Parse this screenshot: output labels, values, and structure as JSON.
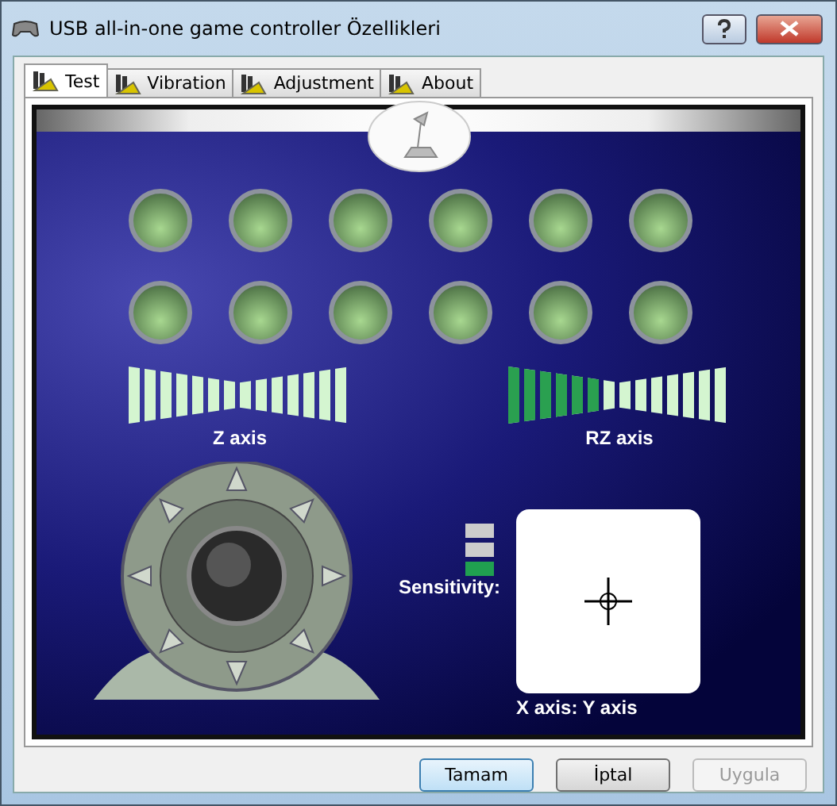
{
  "window": {
    "title": "USB all-in-one game controller Özellikleri"
  },
  "tabs": [
    {
      "label": "Test",
      "selected": true
    },
    {
      "label": "Vibration",
      "selected": false
    },
    {
      "label": "Adjustment",
      "selected": false
    },
    {
      "label": "About",
      "selected": false
    }
  ],
  "controller_buttons": [
    {
      "pressed": false
    },
    {
      "pressed": false
    },
    {
      "pressed": false
    },
    {
      "pressed": false
    },
    {
      "pressed": false
    },
    {
      "pressed": false
    },
    {
      "pressed": false
    },
    {
      "pressed": false
    },
    {
      "pressed": false
    },
    {
      "pressed": false
    },
    {
      "pressed": false
    },
    {
      "pressed": false
    }
  ],
  "axes": [
    {
      "label": "Z axis",
      "level": 0
    },
    {
      "label": "RZ axis",
      "level": 0.43
    }
  ],
  "sensitivity": {
    "label": "Sensitivity:",
    "level": 0.33
  },
  "xy_pad": {
    "label": "X axis: Y axis"
  },
  "buttons": [
    {
      "label": "Tamam",
      "kind": "default",
      "disabled": false
    },
    {
      "label": "İptal",
      "kind": "normal",
      "disabled": false
    },
    {
      "label": "Uygula",
      "kind": "normal",
      "disabled": true
    }
  ]
}
